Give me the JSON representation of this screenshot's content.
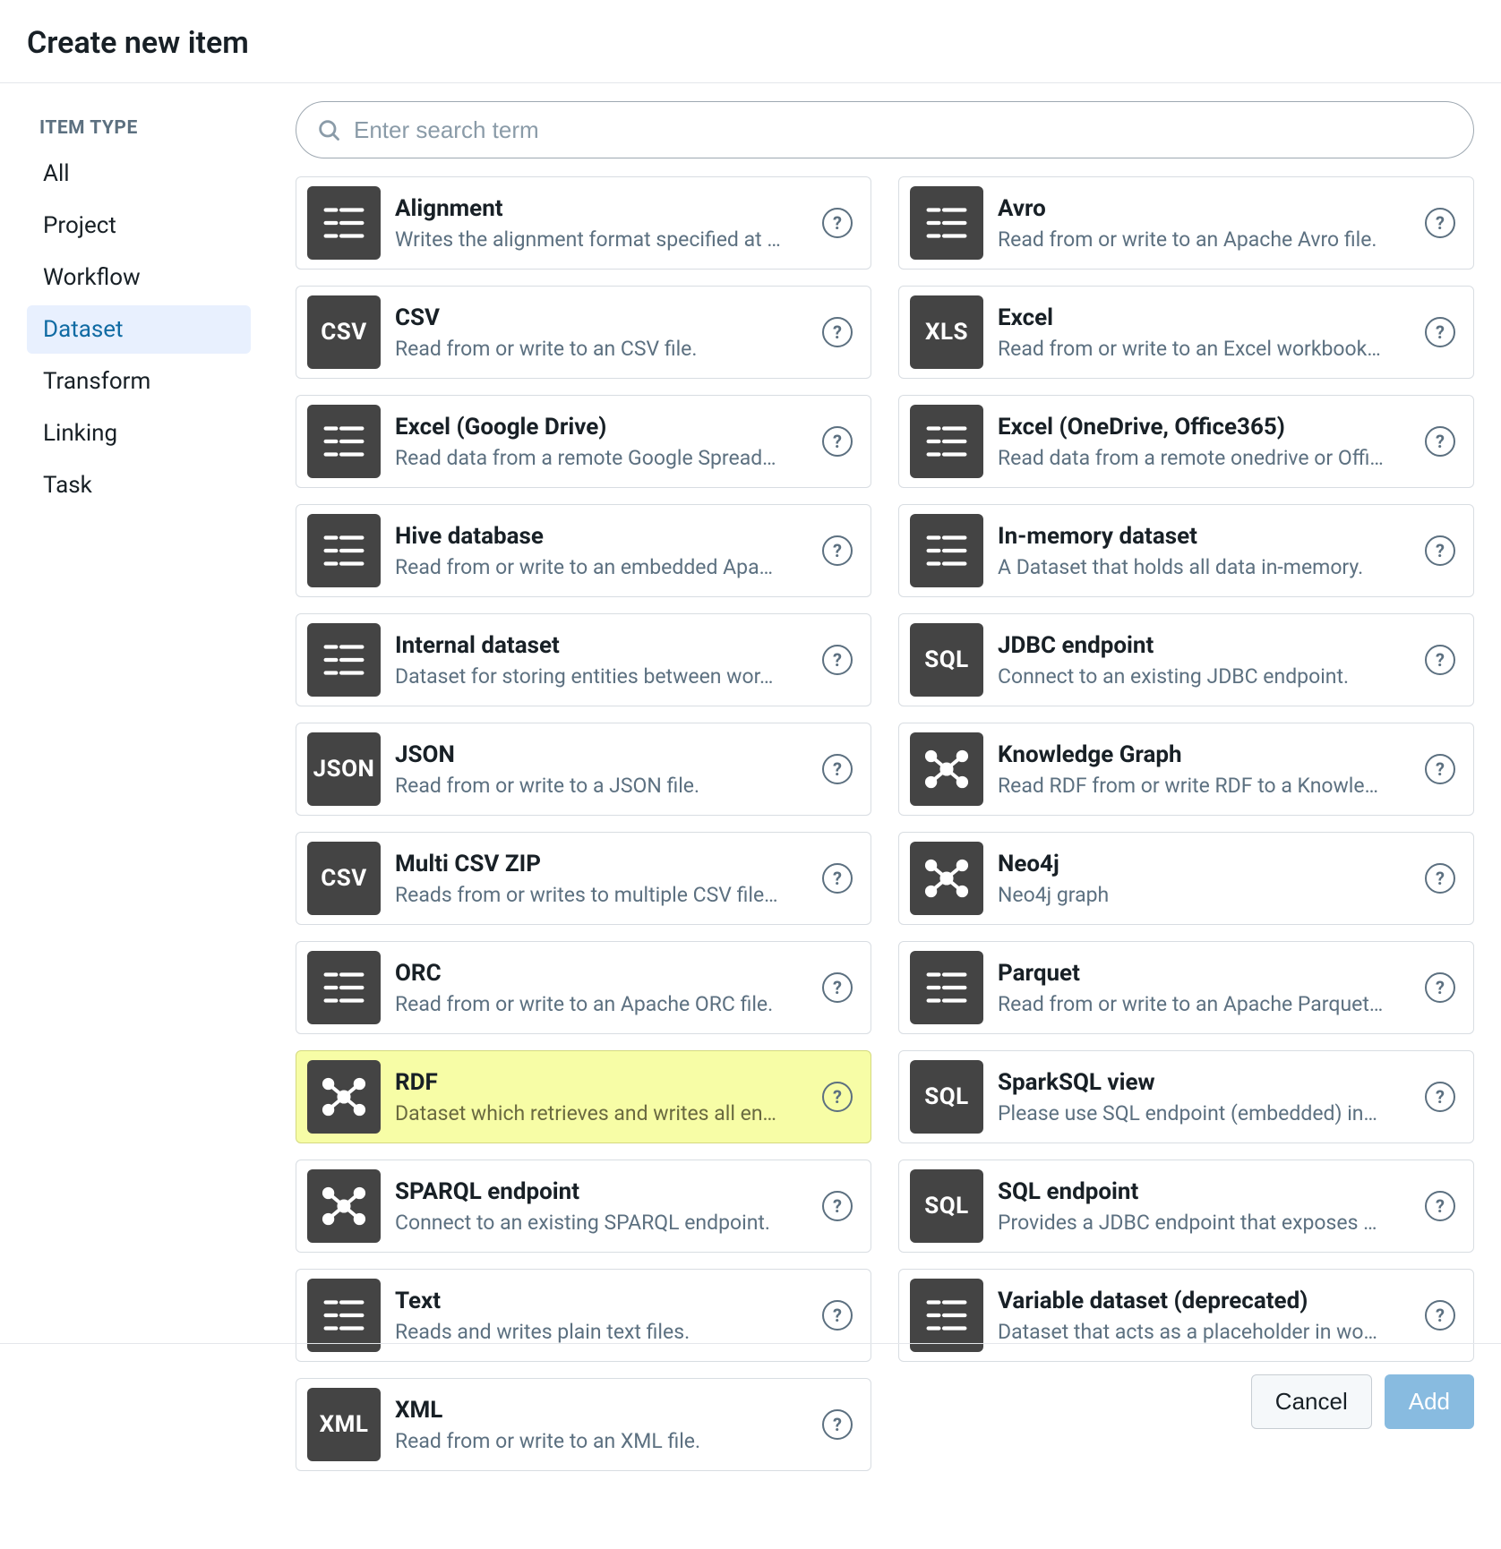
{
  "header": {
    "title": "Create new item"
  },
  "sidebar": {
    "heading": "ITEM TYPE",
    "items": [
      {
        "label": "All",
        "active": false
      },
      {
        "label": "Project",
        "active": false
      },
      {
        "label": "Workflow",
        "active": false
      },
      {
        "label": "Dataset",
        "active": true
      },
      {
        "label": "Transform",
        "active": false
      },
      {
        "label": "Linking",
        "active": false
      },
      {
        "label": "Task",
        "active": false
      }
    ]
  },
  "search": {
    "placeholder": "Enter search term"
  },
  "cards": [
    {
      "title": "Alignment",
      "desc": "Writes the alignment format specified at …",
      "icon": "lines",
      "highlight": false
    },
    {
      "title": "Avro",
      "desc": "Read from or write to an Apache Avro file.",
      "icon": "lines",
      "highlight": false
    },
    {
      "title": "CSV",
      "desc": "Read from or write to an CSV file.",
      "icon": "CSV",
      "highlight": false
    },
    {
      "title": "Excel",
      "desc": "Read from or write to an Excel workbook…",
      "icon": "XLS",
      "highlight": false
    },
    {
      "title": "Excel (Google Drive)",
      "desc": "Read data from a remote Google Spread…",
      "icon": "lines",
      "highlight": false
    },
    {
      "title": "Excel (OneDrive, Office365)",
      "desc": "Read data from a remote onedrive or Offi…",
      "icon": "lines",
      "highlight": false
    },
    {
      "title": "Hive database",
      "desc": "Read from or write to an embedded Apa…",
      "icon": "lines",
      "highlight": false
    },
    {
      "title": "In-memory dataset",
      "desc": "A Dataset that holds all data in-memory.",
      "icon": "lines",
      "highlight": false
    },
    {
      "title": "Internal dataset",
      "desc": "Dataset for storing entities between wor…",
      "icon": "lines",
      "highlight": false
    },
    {
      "title": "JDBC endpoint",
      "desc": "Connect to an existing JDBC endpoint.",
      "icon": "SQL",
      "highlight": false
    },
    {
      "title": "JSON",
      "desc": "Read from or write to a JSON file.",
      "icon": "JSON",
      "highlight": false
    },
    {
      "title": "Knowledge Graph",
      "desc": "Read RDF from or write RDF to a Knowle…",
      "icon": "graph",
      "highlight": false
    },
    {
      "title": "Multi CSV ZIP",
      "desc": "Reads from or writes to multiple CSV file…",
      "icon": "CSV",
      "highlight": false
    },
    {
      "title": "Neo4j",
      "desc": "Neo4j graph",
      "icon": "graph",
      "highlight": false
    },
    {
      "title": "ORC",
      "desc": "Read from or write to an Apache ORC file.",
      "icon": "lines",
      "highlight": false
    },
    {
      "title": "Parquet",
      "desc": "Read from or write to an Apache Parquet…",
      "icon": "lines",
      "highlight": false
    },
    {
      "title": "RDF",
      "desc": "Dataset which retrieves and writes all en…",
      "icon": "graph",
      "highlight": true
    },
    {
      "title": "SparkSQL view",
      "desc": "Please use SQL endpoint (embedded) in…",
      "icon": "SQL",
      "highlight": false
    },
    {
      "title": "SPARQL endpoint",
      "desc": "Connect to an existing SPARQL endpoint.",
      "icon": "graph",
      "highlight": false
    },
    {
      "title": "SQL endpoint",
      "desc": "Provides a JDBC endpoint that exposes …",
      "icon": "SQL",
      "highlight": false
    },
    {
      "title": "Text",
      "desc": "Reads and writes plain text files.",
      "icon": "lines",
      "highlight": false
    },
    {
      "title": "Variable dataset (deprecated)",
      "desc": "Dataset that acts as a placeholder in wo…",
      "icon": "lines",
      "highlight": false
    },
    {
      "title": "XML",
      "desc": "Read from or write to an XML file.",
      "icon": "XML",
      "highlight": false
    }
  ],
  "footer": {
    "cancel": "Cancel",
    "add": "Add"
  }
}
